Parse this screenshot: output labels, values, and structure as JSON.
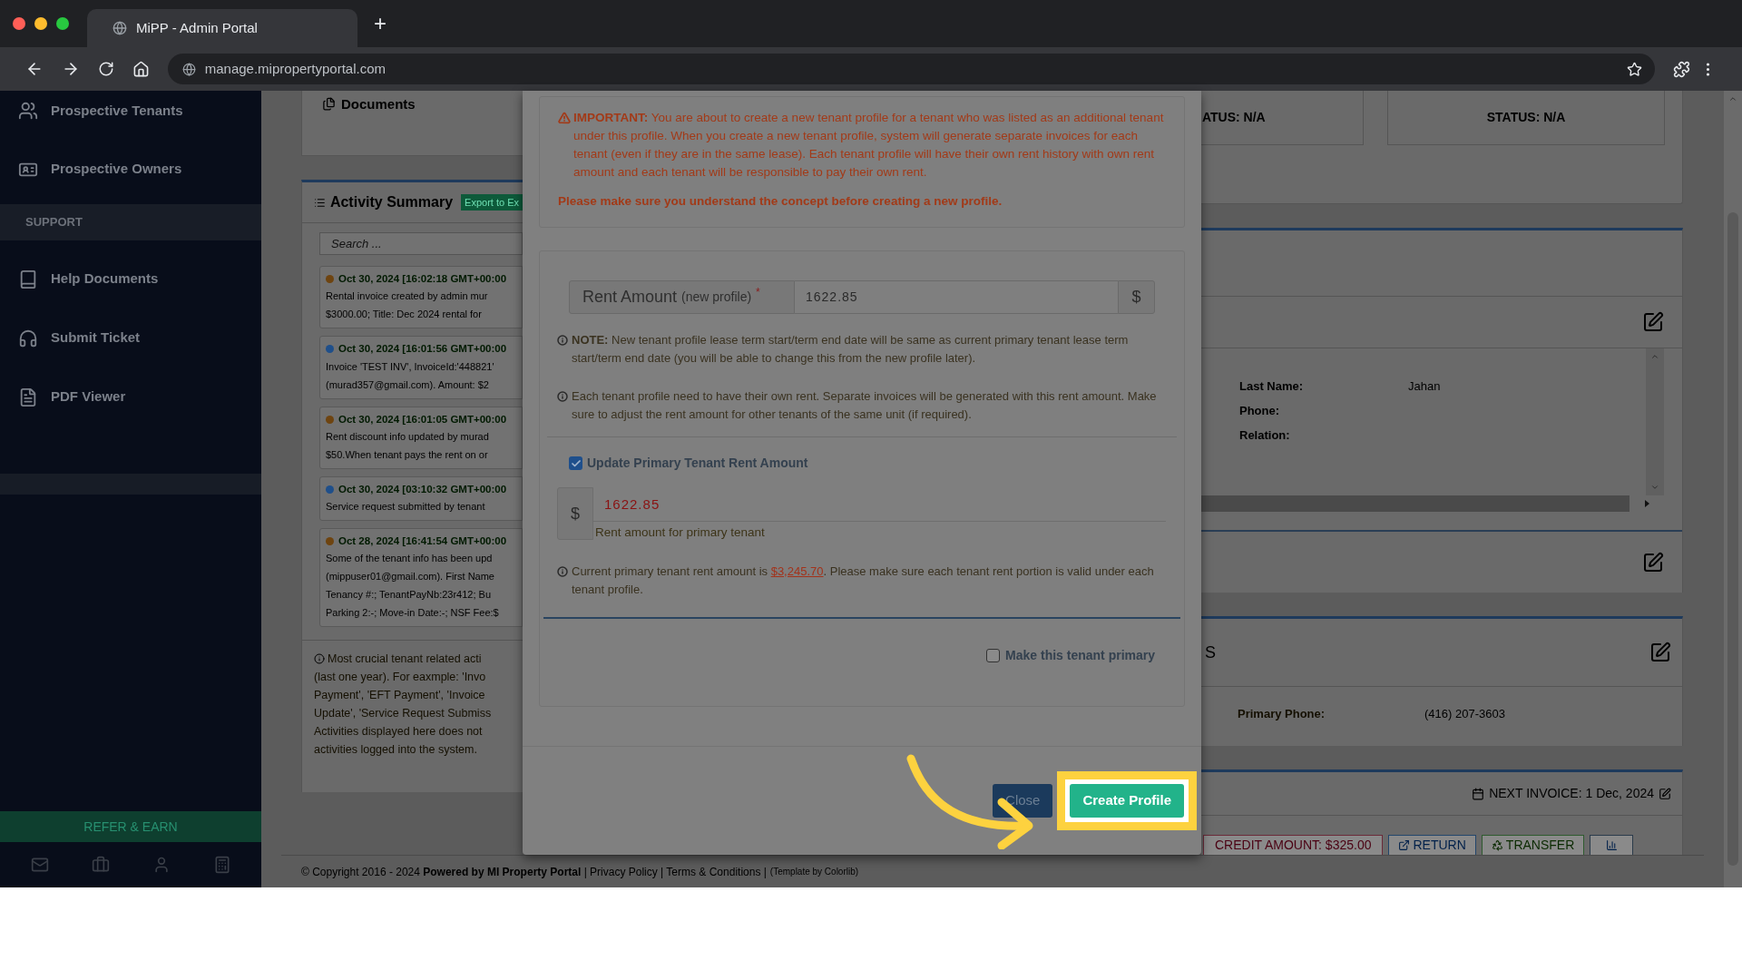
{
  "browser": {
    "tab_title": "MiPP - Admin Portal",
    "new_tab": "+",
    "url": "manage.mipropertyportal.com"
  },
  "sidebar": {
    "top_items": [
      "Prospective Tenants",
      "Prospective Owners"
    ],
    "section_label": "SUPPORT",
    "support_items": [
      "Help Documents",
      "Submit Ticket",
      "PDF Viewer"
    ],
    "refer_button": "REFER & EARN"
  },
  "documents_panel": {
    "title": "Documents"
  },
  "activity_panel": {
    "title": "Activity Summary",
    "export_button": "Export to Ex",
    "search_placeholder": "Search ...",
    "entries": [
      {
        "time": "Oct 30, 2024 [16:02:18 GMT+00:00",
        "color": "#6e4410",
        "lines": [
          "Rental invoice created by admin mur",
          "$3000.00; Title: Dec 2024 rental for"
        ]
      },
      {
        "time": "Oct 30, 2024 [16:01:56 GMT+00:00",
        "color": "#1f4f8a",
        "lines": [
          "Invoice 'TEST INV', InvoiceId:'448821'",
          "(murad357@gmail.com). Amount: $2"
        ]
      },
      {
        "time": "Oct 30, 2024 [16:01:05 GMT+00:00",
        "color": "#6e4410",
        "lines": [
          "Rent discount info updated by murad",
          "$50.When tenant pays the rent on or"
        ]
      },
      {
        "time": "Oct 30, 2024 [03:10:32 GMT+00:00",
        "color": "#1f4f8a",
        "lines": [
          "Service request submitted by tenant"
        ]
      },
      {
        "time": "Oct 28, 2024 [16:41:54 GMT+00:00",
        "color": "#6e4410",
        "lines": [
          "Some of the tenant info has been upd",
          "(mippuser01@gmail.com). First Name",
          "Tenancy #:; TenantPayNb:23r412; Bu",
          "Parking 2:-; Move-in Date:-; NSF Fee:$"
        ]
      }
    ],
    "note_lines": [
      "Most crucial tenant related acti",
      "(last one year). For eaxmple: 'Invo",
      "Payment', 'EFT Payment', 'Invoice",
      "Update', 'Service Request Submiss",
      "Activities displayed here does not",
      "activities logged into the system."
    ]
  },
  "right_panel": {
    "status_boxes": [
      "ATUS: N/A",
      "STATUS: N/A"
    ],
    "contact_fields": [
      {
        "label": "Last Name:",
        "value": "Jahan"
      },
      {
        "label": "Phone:"
      },
      {
        "label": "Relation:"
      }
    ],
    "section_heading": "S",
    "primary_phone": {
      "label": "Primary Phone:",
      "value": "(416) 207-3603"
    },
    "next_invoice": "NEXT INVOICE: 1 Dec, 2024",
    "action_buttons": [
      {
        "kind": "credit",
        "label": "CREDIT AMOUNT: $325.00"
      },
      {
        "kind": "return",
        "label": "RETURN"
      },
      {
        "kind": "transfer",
        "label": "TRANSFER"
      },
      {
        "kind": "chart"
      }
    ]
  },
  "footer": {
    "text": "© Copyright 2016 - 2024 **Powered by MI Property Portal** | Privacy Policy | Terms & Conditions |",
    "template_credit": "(Template by Colorlib)"
  },
  "modal": {
    "warning": {
      "text": "**IMPORTANT:** You are about to create a new tenant profile for a tenant who was listed as an additional tenant under this profile. When you create a new tenant profile, system will generate separate invoices for each tenant (even if they are in the same lease). Each tenant profile will have their own rent history with own rent amount and each tenant will be responsible to pay their own rent.",
      "emphasis": "Please make sure you understand the concept before creating a new profile."
    },
    "rent_amount": {
      "label": "Rent Amount",
      "qualifier": "(new profile)",
      "required_mark": "*",
      "value": "1622.85",
      "addon": "$"
    },
    "notes": [
      "**NOTE:** New tenant profile lease term start/term end date will be same as current primary tenant lease term start/term end date (you will be able to change this from the new profile later).",
      "Each tenant profile need to have their own rent. Separate invoices will be generated with this rent amount. Make sure to adjust the rent amount for other tenants of the same unit (if required)."
    ],
    "update_primary": {
      "label": "Update Primary Tenant Rent Amount",
      "checked": true,
      "addon": "$",
      "value": "1622.85",
      "help": "Rent amount for primary tenant"
    },
    "current_rent_note": {
      "before": "Current primary tenant rent amount is ",
      "amount": "$3,245.70",
      "after": ". Please make sure each tenant rent portion is valid under each tenant profile."
    },
    "make_primary": {
      "label": "Make this tenant primary",
      "checked": false
    },
    "buttons": [
      {
        "kind": "close",
        "label": "Close",
        "highlighted": false
      },
      {
        "kind": "create",
        "label": "Create Profile",
        "highlighted": true
      }
    ]
  }
}
